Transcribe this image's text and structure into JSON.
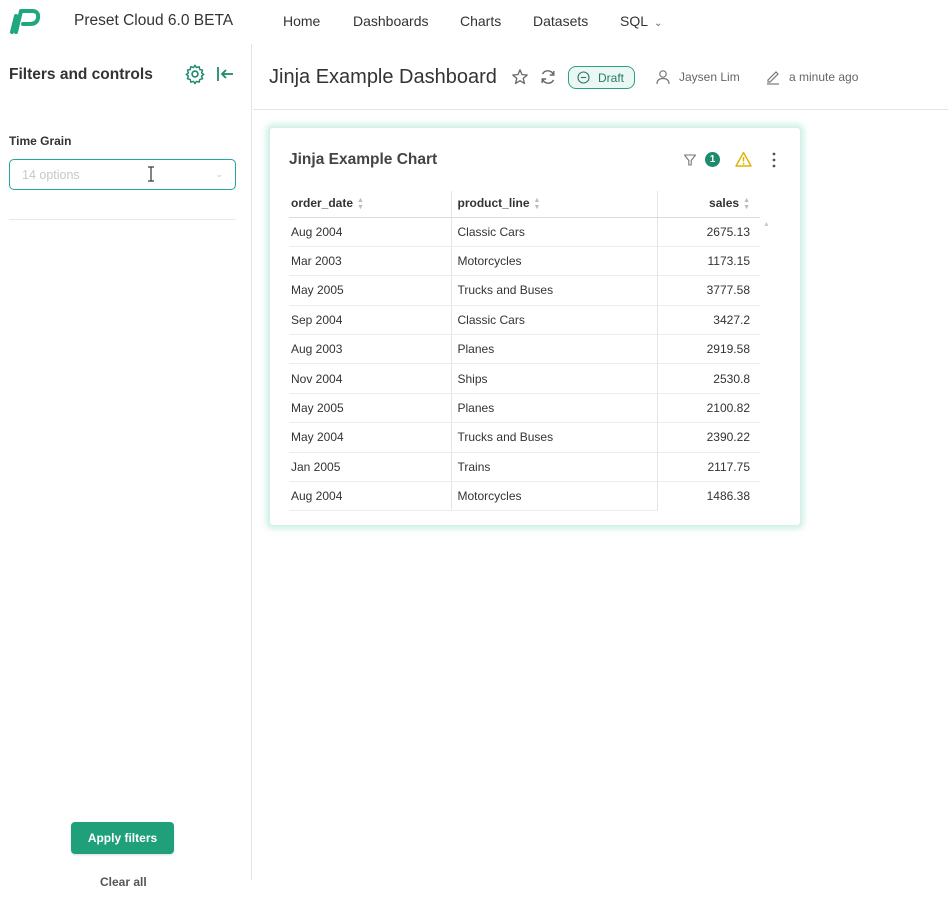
{
  "app": {
    "title": "Preset Cloud 6.0 BETA",
    "logo_icon": "preset-logo-icon",
    "brand_color": "#1fa87f"
  },
  "nav": {
    "items": [
      {
        "label": "Home"
      },
      {
        "label": "Dashboards"
      },
      {
        "label": "Charts"
      },
      {
        "label": "Datasets"
      },
      {
        "label": "SQL"
      }
    ]
  },
  "sidebar": {
    "title": "Filters and controls",
    "filter_label": "Time Grain",
    "filter_placeholder": "14 options",
    "apply_label": "Apply filters",
    "clear_label": "Clear all",
    "accent_color": "#20a07a"
  },
  "header": {
    "title": "Jinja Example Dashboard",
    "status": "Draft",
    "owner": "Jaysen Lim",
    "modified": "a minute ago"
  },
  "chart": {
    "title": "Jinja Example Chart",
    "filter_count": "1",
    "columns": [
      "order_date",
      "product_line",
      "sales"
    ],
    "rows": [
      [
        "Aug 2004",
        "Classic Cars",
        "2675.13"
      ],
      [
        "Mar 2003",
        "Motorcycles",
        "1173.15"
      ],
      [
        "May 2005",
        "Trucks and Buses",
        "3777.58"
      ],
      [
        "Sep 2004",
        "Classic Cars",
        "3427.2"
      ],
      [
        "Aug 2003",
        "Planes",
        "2919.58"
      ],
      [
        "Nov 2004",
        "Ships",
        "2530.8"
      ],
      [
        "May 2005",
        "Planes",
        "2100.82"
      ],
      [
        "May 2004",
        "Trucks and Buses",
        "2390.22"
      ],
      [
        "Jan 2005",
        "Trains",
        "2117.75"
      ],
      [
        "Aug 2004",
        "Motorcycles",
        "1486.38"
      ]
    ]
  }
}
